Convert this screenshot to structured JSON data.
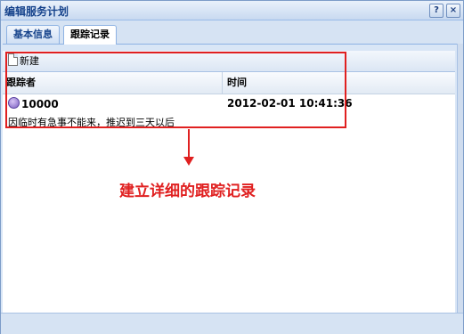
{
  "window": {
    "title": "编辑服务计划"
  },
  "title_buttons": {
    "help": "?",
    "close": "×"
  },
  "tabs": [
    {
      "label": "基本信息"
    },
    {
      "label": "跟踪记录"
    }
  ],
  "toolbar": {
    "new_label": "新建"
  },
  "grid": {
    "columns": [
      "跟踪者",
      "时间"
    ],
    "rows": [
      {
        "tracker": "10000",
        "time": "2012-02-01 10:41:36",
        "note": "因临时有急事不能来，推迟到三天以后"
      }
    ]
  },
  "annotation": {
    "text": "建立详细的跟踪记录",
    "color": "#e02020"
  },
  "colors": {
    "accent": "#15428b",
    "highlight": "#e02020",
    "frame": "#7c9cc8"
  }
}
